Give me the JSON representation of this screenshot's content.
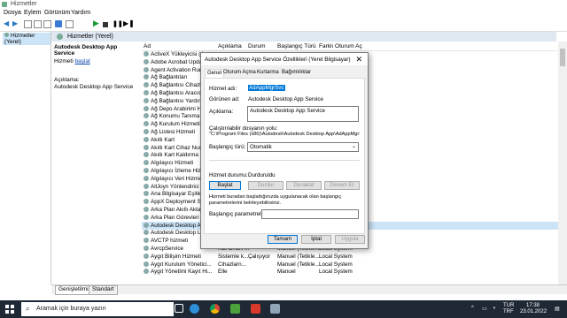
{
  "window": {
    "title": "Hizmetler"
  },
  "menu": [
    "Dosya",
    "Eylem",
    "Görünüm",
    "Yardım"
  ],
  "tree": {
    "root": "Hizmetler (Yerel)"
  },
  "panel": {
    "header": "Hizmetler (Yerel)",
    "selected_name": "Autodesk Desktop App Service",
    "start_prefix": "Hizmeti ",
    "start_link": "başlat",
    "desc_label": "Açıklama:",
    "desc_value": "Autodesk Desktop App Service"
  },
  "columns": [
    "Ad",
    "Açıklama",
    "Durum",
    "Başlangıç Türü",
    "Farklı Oturum Aç"
  ],
  "rows": [
    {
      "name": "ActiveX Yükleyicisi (Ax..."
    },
    {
      "name": "Adobe Acrobat Update..."
    },
    {
      "name": "Agent Activation Runti..."
    },
    {
      "name": "Ağ Bağlantıları"
    },
    {
      "name": "Ağ Bağlantısı Cihazları..."
    },
    {
      "name": "Ağ Bağlantısı Aracısı"
    },
    {
      "name": "Ağ Bağlantısı Yardımcı..."
    },
    {
      "name": "Ağ Depo Arabirimi Hiz..."
    },
    {
      "name": "Ağ Konumu Tanıma"
    },
    {
      "name": "Ağ Kurulum Hizmeti"
    },
    {
      "name": "Ağ Listesi Hizmeti"
    },
    {
      "name": "Akıllı Kart"
    },
    {
      "name": "Akıllı Kart Cihaz Numa..."
    },
    {
      "name": "Akıllı Kart Kaldırma İlke..."
    },
    {
      "name": "Algılayıcı Hizmeti"
    },
    {
      "name": "Algılayıcı İzleme Hizm..."
    },
    {
      "name": "Algılayıcı Veri Hizmeti"
    },
    {
      "name": "AllJoyn Yönlendirici Hiz..."
    },
    {
      "name": "Ana Bilgisayar Eşitle_5..."
    },
    {
      "name": "AppX Deployment Servi..."
    },
    {
      "name": "Arka Plan Akıllı Aktarım..."
    },
    {
      "name": "Arka Plan Görevleri Altı..."
    },
    {
      "name": "Autodesk Desktop App..."
    },
    {
      "name": "Autodesk Desktop Lice..."
    },
    {
      "name": "AVCTP hizmeti"
    },
    {
      "name": "AvrcpService",
      "desc": "REALTEK ...",
      "status": "",
      "start": "Manuel (Tetikle...",
      "logon": "Local System"
    },
    {
      "name": "Aygıt Bilişim Hizmeti",
      "desc": "Sistemle k...",
      "status": "Çalışıyor",
      "start": "Manuel (Tetikle...",
      "logon": "Local System"
    },
    {
      "name": "Aygıt Kurulum Yönetici...",
      "desc": "Cihazlarn...",
      "status": "",
      "start": "Manuel (Tetikle...",
      "logon": "Local System"
    },
    {
      "name": "Aygıt Yönetimi Kayıt Hi...",
      "desc": "Elle",
      "status": "",
      "start": "Manuel",
      "logon": "Local System"
    }
  ],
  "tabs": [
    "Genişletilmiş",
    "Standart"
  ],
  "dialog": {
    "title": "Autodesk Desktop App Service Özellikleri (Yerel Bilgisayar)",
    "close": "✕",
    "tabs": [
      "Genel",
      "Oturum Açma",
      "Kurtarma",
      "Bağımlılıklar"
    ],
    "service_name_label": "Hizmet adı:",
    "service_name": "AdAppMgrSvc",
    "display_name_label": "Görünen ad:",
    "display_name": "Autodesk Desktop App Service",
    "desc_label": "Açıklama:",
    "desc": "Autodesk Desktop App Service",
    "path_label": "Çalıştırılabilir dosyanın yolu:",
    "path": "\"C:\\Program Files (x86)\\Autodesk\\Autodesk Desktop App\\AdAppMgrSvc.e",
    "startup_label": "Başlangıç türü:",
    "startup": "Otomatik",
    "status_label": "Hizmet durumu:",
    "status": "Durduruldu",
    "btn_start": "Başlat",
    "btn_stop": "Durdur",
    "btn_pause": "Duraklat",
    "btn_resume": "Devam Et",
    "hint": "Hizmeti buradan başlattığınızda uygulanacak olan başlangıç parametrelerini belirleyebilirsiniz.",
    "params_label": "Başlangıç parametreleri:",
    "ok": "Tamam",
    "cancel": "İptal",
    "apply": "Uygula"
  },
  "taskbar": {
    "search": "Aramak için buraya yazın",
    "lang": "TUR",
    "lang2": "TRF",
    "time": "17:38",
    "date": "23.01.2022"
  }
}
